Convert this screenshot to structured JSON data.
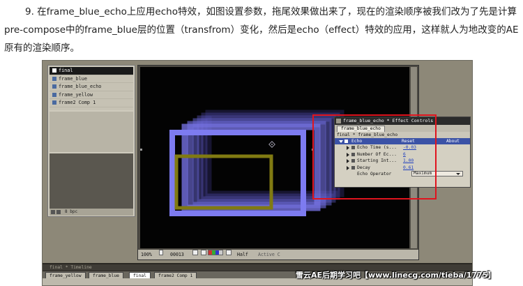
{
  "article": {
    "paragraph": "9. 在frame_blue_echo上应用echo特效，如图设置参数，拖尾效果做出来了，现在的渲染顺序被我们改为了先是计算pre-compose中的frame_blue层的位置（transfrom）变化，然后是echo（effect）特效的应用，这样就人为地改变的AE原有的渲染顺序。"
  },
  "project": {
    "items": [
      {
        "label": "final",
        "selected": true
      },
      {
        "label": "frame_blue",
        "selected": false
      },
      {
        "label": "frame_blue_echo",
        "selected": false
      },
      {
        "label": "frame_yellow",
        "selected": false
      },
      {
        "label": "frame2 Comp 1",
        "selected": false
      }
    ],
    "footer": "8 bpc"
  },
  "comp": {
    "zoom": "100%",
    "timecode": "00013",
    "resolution": "Half",
    "view": "Active C"
  },
  "effect_controls": {
    "title": "frame_blue_echo * Effect Controls",
    "tab": "frame_blue_echo",
    "breadcrumb": "final * frame_blue_echo",
    "effect_name": "Echo",
    "reset_label": "Reset",
    "about_label": "About",
    "params": [
      {
        "label": "Echo Time (s...",
        "value": "-0.03"
      },
      {
        "label": "Number Of Ec...",
        "value": "6"
      },
      {
        "label": "Starting Int...",
        "value": "1.00"
      },
      {
        "label": "Decay",
        "value": "0.61"
      }
    ],
    "operator_label": "Echo Operator",
    "operator_value": "Maximum",
    "colors": {
      "highlight": "#e0141e",
      "header": "#3b52a6"
    }
  },
  "timeline": {
    "title": "final * Timeline",
    "tabs": [
      "frame_yellow",
      "frame_blue",
      "final",
      "frame2 Comp 1"
    ],
    "active_tab": "final"
  },
  "watermark": "雪云AE后期学习吧【www.linecg.com/tieba/1775】"
}
